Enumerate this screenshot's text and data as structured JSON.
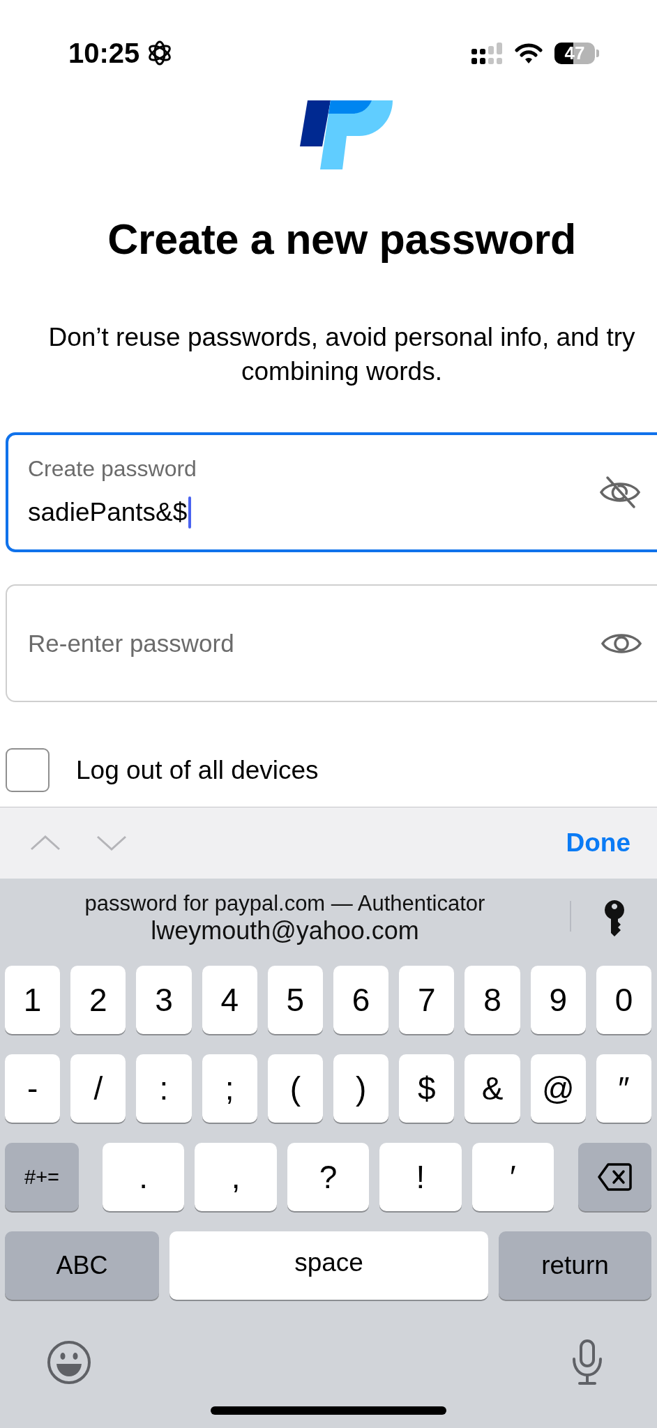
{
  "status_bar": {
    "time": "10:25",
    "battery": "47"
  },
  "title": "Create a new password",
  "subtitle": "Don’t reuse passwords, avoid personal info, and try combining words.",
  "fields": [
    {
      "label": "Create password",
      "value": "sadiePants&$",
      "focused": true,
      "password_visible": true
    },
    {
      "placeholder": "Re-enter password",
      "focused": false,
      "password_visible": false
    }
  ],
  "checkbox": {
    "label": "Log out of all devices",
    "checked": false
  },
  "keyboard_toolbar": {
    "done": "Done"
  },
  "autofill": {
    "caption": "password for paypal.com — Authenticator",
    "account": "lweymouth@yahoo.com"
  },
  "keyboard": {
    "number_row": [
      {
        "kind": "char",
        "label": "1"
      },
      {
        "kind": "char",
        "label": "2"
      },
      {
        "kind": "char",
        "label": "3"
      },
      {
        "kind": "char",
        "label": "4"
      },
      {
        "kind": "char",
        "label": "5"
      },
      {
        "kind": "char",
        "label": "6"
      },
      {
        "kind": "char",
        "label": "7"
      },
      {
        "kind": "char",
        "label": "8"
      },
      {
        "kind": "char",
        "label": "9"
      },
      {
        "kind": "char",
        "label": "0"
      }
    ],
    "symbol_row": [
      {
        "kind": "char",
        "label": "-"
      },
      {
        "kind": "char",
        "label": "/"
      },
      {
        "kind": "char",
        "label": ":"
      },
      {
        "kind": "char",
        "label": ";"
      },
      {
        "kind": "char",
        "label": "("
      },
      {
        "kind": "char",
        "label": ")"
      },
      {
        "kind": "char",
        "label": "$"
      },
      {
        "kind": "char",
        "label": "&"
      },
      {
        "kind": "char",
        "label": "@"
      },
      {
        "kind": "char",
        "label": "″"
      }
    ],
    "punctuation_row": [
      {
        "kind": "symbols",
        "label": "#+="
      },
      {
        "kind": "char",
        "label": "."
      },
      {
        "kind": "char",
        "label": ","
      },
      {
        "kind": "char",
        "label": "?"
      },
      {
        "kind": "char",
        "label": "!"
      },
      {
        "kind": "char",
        "label": "′"
      },
      {
        "kind": "delete"
      }
    ],
    "bottom_row": [
      {
        "kind": "mode",
        "label": "ABC"
      },
      {
        "kind": "space",
        "label": "space"
      },
      {
        "kind": "return",
        "label": "return"
      }
    ]
  }
}
